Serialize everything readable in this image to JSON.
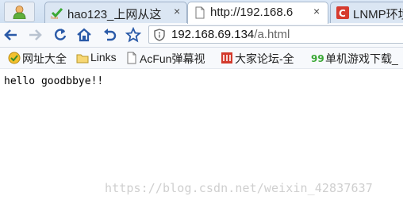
{
  "tabs": [
    {
      "title": "hao123_上网从这",
      "close": "×"
    },
    {
      "title": "http://192.168.6",
      "close": "×"
    },
    {
      "title": "LNMP环境"
    }
  ],
  "address_bar": {
    "host": "192.168.69.134",
    "path": "/a.html"
  },
  "bookmarks": [
    {
      "label": "网址大全",
      "icon": "web-directory-icon"
    },
    {
      "label": "Links",
      "icon": "folder-icon"
    },
    {
      "label": "AcFun弹幕视",
      "icon": "page-icon"
    },
    {
      "label": "大家论坛-全",
      "icon": "book-icon"
    },
    {
      "label": "单机游戏下载_",
      "icon": "game-99-icon"
    }
  ],
  "page": {
    "body_text": "hello goodbbye!!"
  },
  "watermark": "https://blog.csdn.net/weixin_42837637",
  "colors": {
    "nav_icon": "#2a5aa8",
    "hao_green": "#3aa835",
    "lnmp_red": "#d63b2f",
    "bookmark_red": "#d33a2c"
  }
}
